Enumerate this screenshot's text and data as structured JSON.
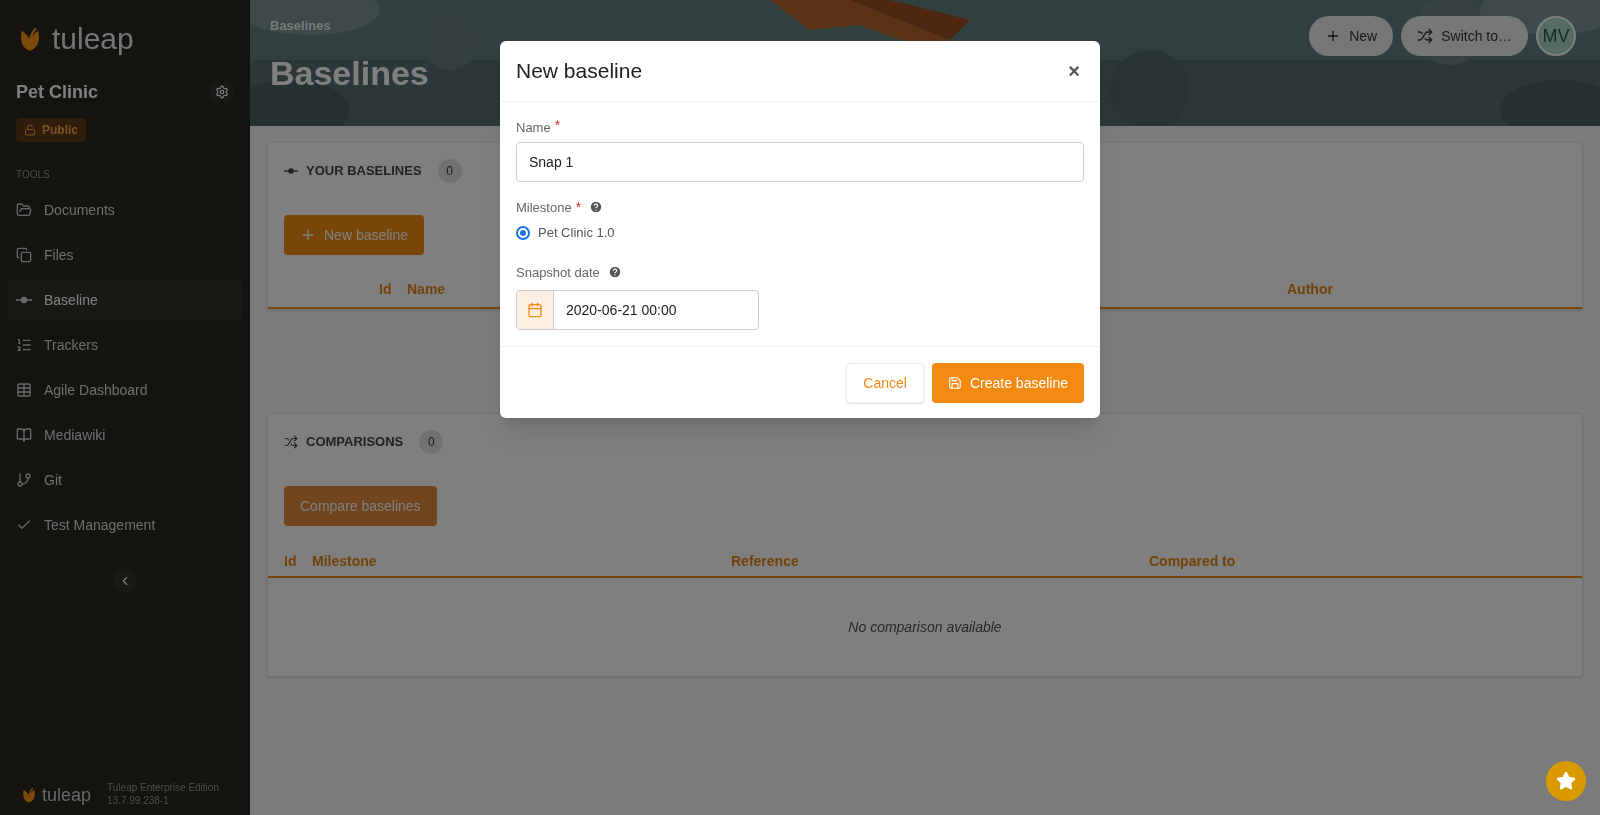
{
  "sidebar": {
    "logo": "tuleap",
    "project": {
      "name": "Pet Clinic",
      "badge": "Public"
    },
    "section": "TOOLS",
    "items": [
      {
        "label": "Documents",
        "kind": "folder",
        "selected": false
      },
      {
        "label": "Files",
        "kind": "files",
        "selected": false
      },
      {
        "label": "Baseline",
        "kind": "baseline",
        "selected": true
      },
      {
        "label": "Trackers",
        "kind": "list",
        "selected": false
      },
      {
        "label": "Agile Dashboard",
        "kind": "table",
        "selected": false
      },
      {
        "label": "Mediawiki",
        "kind": "wiki",
        "selected": false
      },
      {
        "label": "Git",
        "kind": "git",
        "selected": false
      },
      {
        "label": "Test Management",
        "kind": "check",
        "selected": false
      }
    ],
    "footer": {
      "logo": "tuleap",
      "edition": "Tuleap Enterprise Edition",
      "version": "13.7.99.238-1"
    }
  },
  "header": {
    "breadcrumb": "Baselines",
    "title": "Baselines",
    "actions": [
      {
        "label": "New",
        "kind": "plus"
      },
      {
        "label": "Switch to…",
        "kind": "shuffle"
      }
    ],
    "avatar": "MV"
  },
  "baselines_section": {
    "title": "YOUR BASELINES",
    "count": "0",
    "button": {
      "label": "New baseline",
      "disabled": false
    },
    "columns": [
      "Id",
      "Name",
      "Author"
    ]
  },
  "comparisons_section": {
    "title": "COMPARISONS",
    "count": "0",
    "button": {
      "label": "Compare baselines",
      "disabled": true
    },
    "columns": [
      "Id",
      "Milestone",
      "Reference",
      "Compared to"
    ],
    "empty": "No comparison available"
  },
  "modal": {
    "title": "New baseline",
    "close": "×",
    "name": {
      "label": "Name",
      "required_mark": "*",
      "value": "Snap 1"
    },
    "milestone": {
      "label": "Milestone",
      "required_mark": "*",
      "options": [
        {
          "label": "Pet Clinic 1.0",
          "selected": true
        }
      ]
    },
    "snapshot_date": {
      "label": "Snapshot date",
      "value": "2020-06-21 00:00"
    },
    "buttons": [
      {
        "label": "Cancel",
        "kind": "secondary"
      },
      {
        "label": "Create baseline",
        "kind": "primary"
      }
    ]
  }
}
